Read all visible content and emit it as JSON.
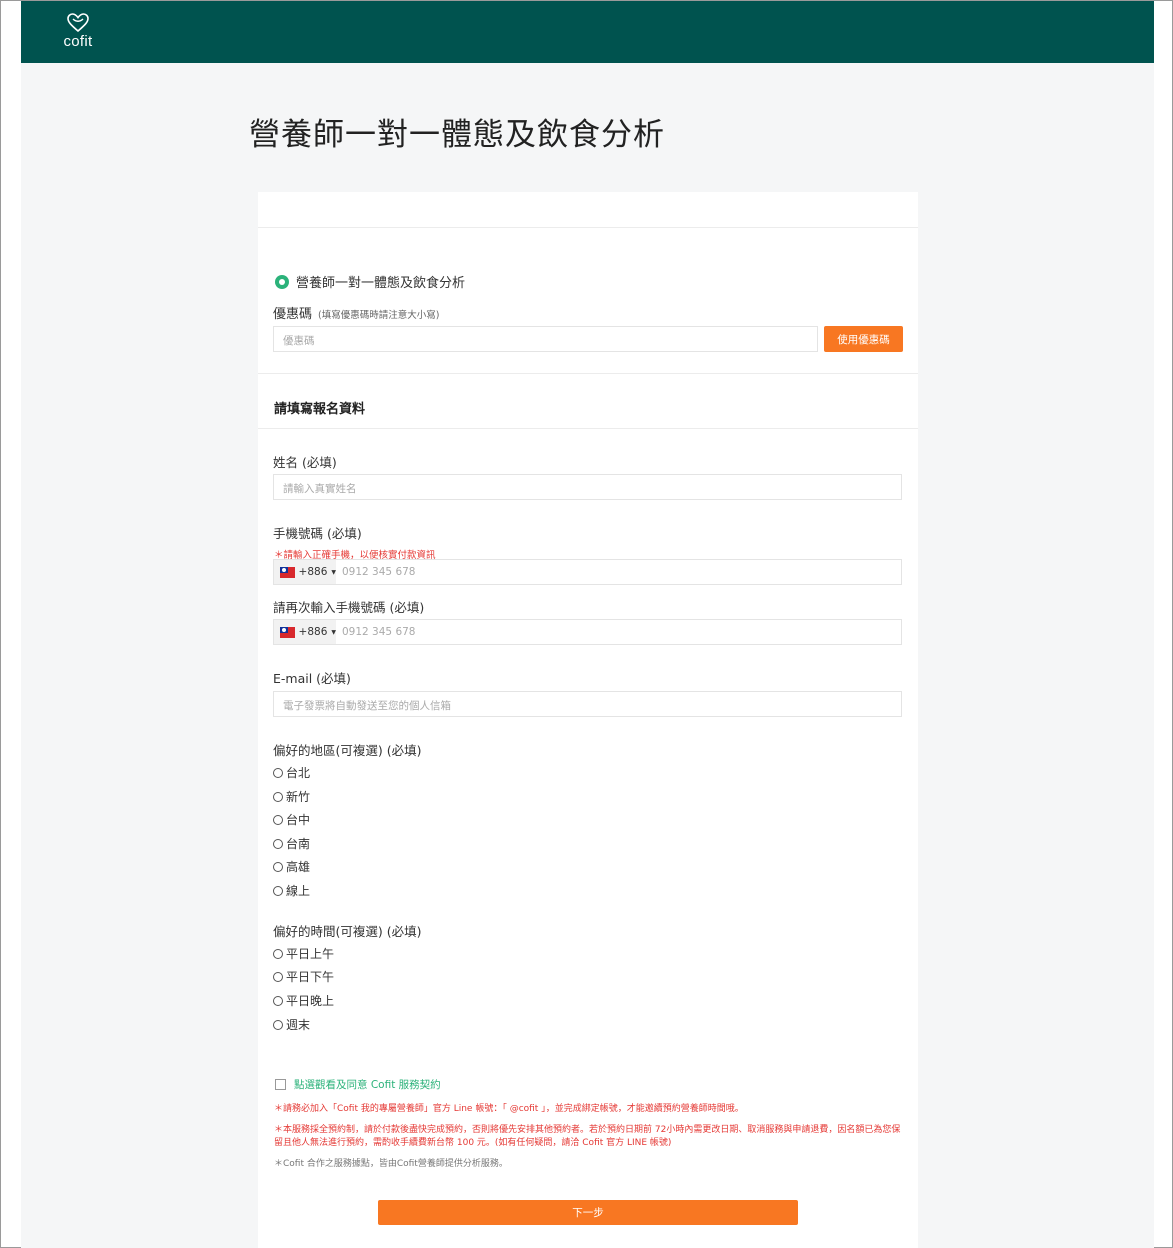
{
  "header": {
    "logo_text": "cofit",
    "brand_color": "#00534f"
  },
  "page": {
    "title": "營養師一對一體態及飲食分析"
  },
  "product": {
    "selected_label": "營養師一對一體態及飲食分析"
  },
  "coupon": {
    "label": "優惠碼",
    "hint": "(填寫優惠碼時請注意大小寫)",
    "placeholder": "優惠碼",
    "button_label": "使用優惠碼"
  },
  "form": {
    "section_title": "請填寫報名資料",
    "name": {
      "label": "姓名 (必填)",
      "placeholder": "請輸入真實姓名"
    },
    "phone": {
      "label": "手機號碼 (必填)",
      "warning": "＊請輸入正確手機，以便核實付款資訊",
      "country_code": "+886",
      "placeholder": "0912 345 678"
    },
    "phone_confirm": {
      "label": "請再次輸入手機號碼 (必填)",
      "country_code": "+886",
      "placeholder": "0912 345 678"
    },
    "email": {
      "label": "E-mail (必填)",
      "placeholder": "電子發票將自動發送至您的個人信箱"
    },
    "region": {
      "label": "偏好的地區(可複選) (必填)",
      "options": [
        "台北",
        "新竹",
        "台中",
        "台南",
        "高雄",
        "線上"
      ]
    },
    "time": {
      "label": "偏好的時間(可複選) (必填)",
      "options": [
        "平日上午",
        "平日下午",
        "平日晚上",
        "週末"
      ]
    },
    "agree_label": "點選觀看及同意 Cofit 服務契約",
    "notes": [
      "＊請務必加入「Cofit 我的專屬營養師」官方 Line 帳號：「 @cofit 」，並完成綁定帳號，才能邀續預約營養師時間哦。",
      "＊本服務採全預約制，請於付款後盡快完成預約，否則將優先安排其他預約者。若於預約日期前 72小時內需更改日期、取消服務與申請退費，因名額已為您保留且他人無法進行預約，需酌收手續費新台幣 100 元。(如有任何疑問，請洽 Cofit 官方 LINE 帳號)",
      "＊Cofit 合作之服務據點，皆由Cofit營養師提供分析服務。"
    ],
    "next_button": "下一步"
  },
  "colors": {
    "accent_orange": "#f87722",
    "accent_green": "#2bb27a",
    "warning_red": "#e53935"
  }
}
